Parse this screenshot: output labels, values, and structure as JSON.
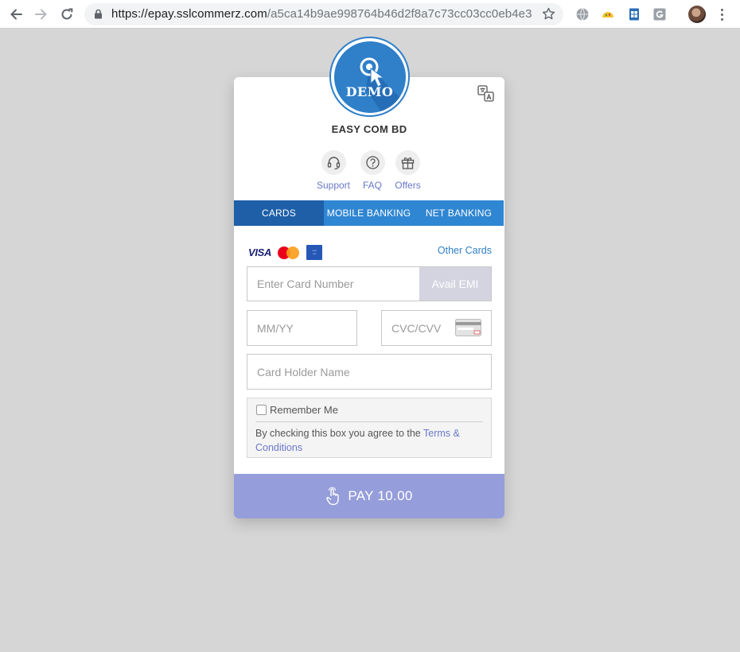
{
  "browser": {
    "url_host": "https://epay.sslcommerz.com",
    "url_path": "/a5ca14b9ae998764b46d2f8a7c73cc03cc0eb4e3"
  },
  "logo": {
    "text": "DEMO"
  },
  "merchant": {
    "name": "EASY COM BD"
  },
  "quick_links": [
    {
      "label": "Support",
      "icon": "headset-icon"
    },
    {
      "label": "FAQ",
      "icon": "question-icon"
    },
    {
      "label": "Offers",
      "icon": "gift-icon"
    }
  ],
  "tabs": [
    {
      "label": "CARDS",
      "active": true
    },
    {
      "label": "MOBILE BANKING",
      "active": false
    },
    {
      "label": "NET BANKING",
      "active": false
    }
  ],
  "card_brands": {
    "visa": "VISA",
    "other_cards": "Other Cards"
  },
  "form": {
    "card_number_placeholder": "Enter Card Number",
    "emi_label": "Avail EMI",
    "expiry_placeholder": "MM/YY",
    "cvv_placeholder": "CVC/CVV",
    "holder_placeholder": "Card Holder Name",
    "remember_label": "Remember Me",
    "terms_prefix": "By checking this box you agree to the ",
    "terms_link": "Terms & Conditions"
  },
  "pay": {
    "label": "PAY 10.00"
  },
  "colors": {
    "primary": "#2f86d2",
    "tab_active": "#1e5fa8",
    "pay_button": "#959ddb",
    "link": "#2f7fc9"
  }
}
